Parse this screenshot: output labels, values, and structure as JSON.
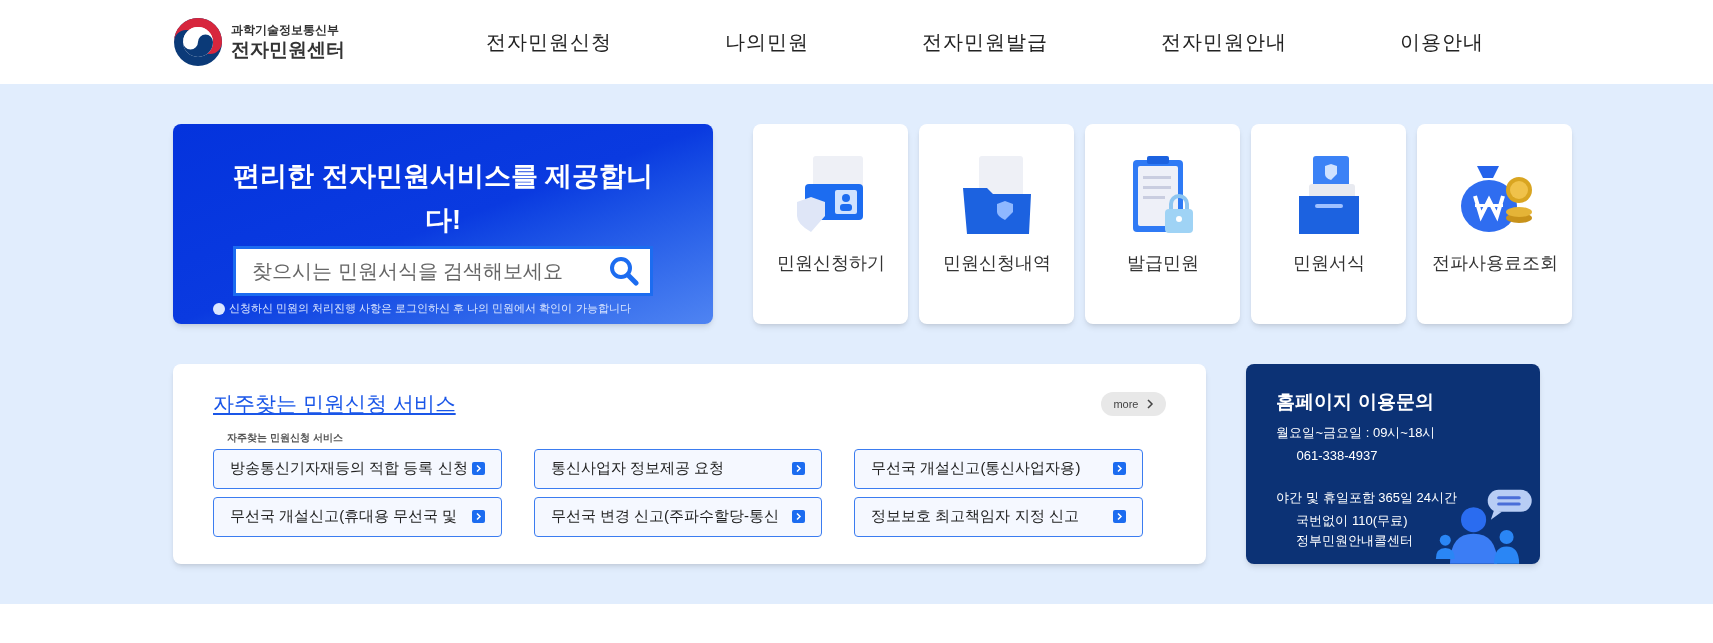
{
  "header": {
    "logo": {
      "ministry": "과학기술정보통신부",
      "title": "전자민원센터"
    },
    "nav": [
      {
        "label": "전자민원신청"
      },
      {
        "label": "나의민원"
      },
      {
        "label": "전자민원발급"
      },
      {
        "label": "전자민원안내"
      },
      {
        "label": "이용안내"
      }
    ]
  },
  "hero": {
    "title": "편리한 전자민원서비스를 제공합니다!",
    "search": {
      "placeholder": "찾으시는 민원서식을 검색해보세요"
    },
    "note": "신청하신 민원의 처리진행 사항은 로그인하신 후 나의 민원에서 확인이 가능합니다"
  },
  "quick_links": [
    {
      "label": "민원신청하기",
      "kind": "application"
    },
    {
      "label": "민원신청내역",
      "kind": "history"
    },
    {
      "label": "발급민원",
      "kind": "issuance"
    },
    {
      "label": "민원서식",
      "kind": "forms"
    },
    {
      "label": "전파사용료조회",
      "kind": "fee"
    }
  ],
  "frequent": {
    "title": "자주찾는 민원신청 서비스",
    "more": "more",
    "caption": "자주찾는 민원신청 서비스",
    "items": [
      "방송통신기자재등의 적합 등록 신청",
      "통신사업자 정보제공 요청",
      "무선국 개설신고(통신사업자용)",
      "무선국 개설신고(휴대용 무선국 및",
      "무선국 변경 신고(주파수할당-통신",
      "정보보호 최고책임자 지정 신고"
    ]
  },
  "support": {
    "title": "홈페이지 이용문의",
    "hours": "월요일~금요일 : 09시~18시",
    "phone": "061-338-4937",
    "night": "야간 및 휴일포함 365일 24시간",
    "hotline": "국번없이 110(무료)",
    "center": "정부민원안내콜센터"
  }
}
